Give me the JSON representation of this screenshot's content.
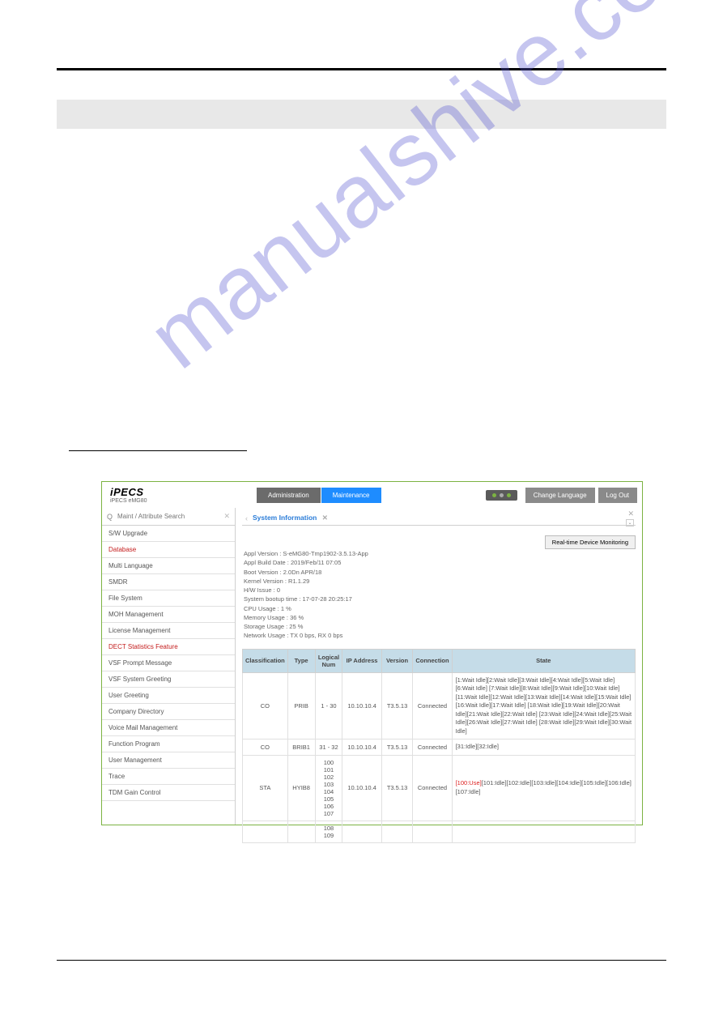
{
  "watermark": "manualshive.com",
  "header": {
    "logo": "iPECS",
    "logo_sub": "iPECS eMG80",
    "tab_admin": "Administration",
    "tab_maintenance": "Maintenance",
    "btn_language": "Change Language",
    "btn_logout": "Log Out"
  },
  "sidebar": {
    "search_placeholder": "Maint / Attribute Search",
    "items": [
      {
        "label": "S/W Upgrade",
        "red": false
      },
      {
        "label": "Database",
        "red": true
      },
      {
        "label": "Multi Language",
        "red": false
      },
      {
        "label": "SMDR",
        "red": false
      },
      {
        "label": "File System",
        "red": false
      },
      {
        "label": "MOH Management",
        "red": false
      },
      {
        "label": "License Management",
        "red": false
      },
      {
        "label": "DECT Statistics Feature",
        "red": true
      },
      {
        "label": "VSF Prompt Message",
        "red": false
      },
      {
        "label": "VSF System Greeting",
        "red": false
      },
      {
        "label": "User Greeting",
        "red": false
      },
      {
        "label": "Company Directory",
        "red": false
      },
      {
        "label": "Voice Mail Management",
        "red": false
      },
      {
        "label": "Function Program",
        "red": false
      },
      {
        "label": "User Management",
        "red": false
      },
      {
        "label": "Trace",
        "red": false
      },
      {
        "label": "TDM Gain Control",
        "red": false
      }
    ]
  },
  "main": {
    "tab_title": "System Information",
    "btn_realtime": "Real-time Device Monitoring",
    "sysinfo": {
      "appl_version": "Appl Version : S-eMG80-Tmp1902-3.5.13-App",
      "appl_build": "Appl Build Date : 2019/Feb/11 07:05",
      "boot_version": "Boot Version : 2.0Dn APR/18",
      "kernel_version": "Kernel Version : R1.1.29",
      "hw_issue": "H/W Issue : 0",
      "system_bootup": "System bootup time : 17-07-28 20:25:17",
      "cpu_usage": "CPU Usage : 1 %",
      "memory_usage": "Memory Usage : 36 %",
      "storage_usage": "Storage Usage : 25 %",
      "network_usage": "Network Usage : TX 0 bps, RX 0 bps"
    },
    "table": {
      "headers": [
        "Classification",
        "Type",
        "Logical Num",
        "IP Address",
        "Version",
        "Connection",
        "State"
      ],
      "rows": [
        {
          "classification": "CO",
          "type": "PRIB",
          "logical_num": "1 - 30",
          "ip": "10.10.10.4",
          "version": "T3.5.13",
          "connection": "Connected",
          "state_segments": [
            {
              "t": "[1:Wait Idle][2:Wait Idle][3:Wait Idle][4:Wait Idle][5:Wait Idle][6:Wait Idle] [7:Wait Idle][8:Wait Idle][9:Wait Idle][10:Wait Idle][11:Wait Idle][12:Wait Idle][13:Wait Idle][14:Wait Idle][15:Wait Idle][16:Wait Idle][17:Wait Idle] [18:Wait Idle][19:Wait Idle][20:Wait Idle][21:Wait Idle][22:Wait Idle] [23:Wait Idle][24:Wait Idle][25:Wait Idle][26:Wait Idle][27:Wait Idle] [28:Wait Idle][29:Wait Idle][30:Wait Idle]",
              "c": ""
            }
          ]
        },
        {
          "classification": "CO",
          "type": "BRIB1",
          "logical_num": "31 - 32",
          "ip": "10.10.10.4",
          "version": "T3.5.13",
          "connection": "Connected",
          "state_segments": [
            {
              "t": "[31:Idle][32:Idle]",
              "c": ""
            }
          ]
        },
        {
          "classification": "STA",
          "type": "HYIB8",
          "logical_num": "100\n101\n102\n103\n104\n105\n106\n107",
          "ip": "10.10.10.4",
          "version": "T3.5.13",
          "connection": "Connected",
          "state_segments": [
            {
              "t": "[100:Use]",
              "c": "red-text"
            },
            {
              "t": "[101:Idle][102:Idle][103:Idle][104:Idle][105:Idle][106:Idle] [107:Idle]",
              "c": ""
            }
          ]
        },
        {
          "classification": "",
          "type": "",
          "logical_num": "108\n109",
          "ip": "",
          "version": "",
          "connection": "",
          "state_segments": []
        }
      ]
    }
  }
}
